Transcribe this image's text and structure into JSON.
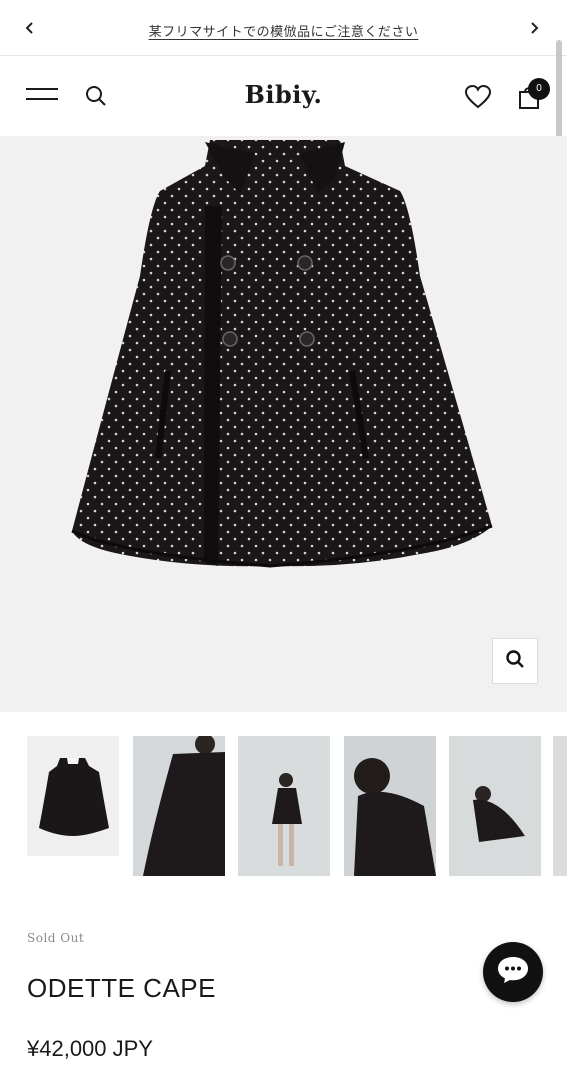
{
  "announcement": {
    "message": "某フリマサイトでの模倣品にご注意ください",
    "prev_icon": "chevron-left-icon",
    "next_icon": "chevron-right-icon"
  },
  "header": {
    "logo": "Bibiy.",
    "menu_icon": "hamburger-icon",
    "search_icon": "search-icon",
    "wishlist_icon": "heart-icon",
    "cart_icon": "shopping-bag-icon",
    "cart_count": "0"
  },
  "gallery": {
    "zoom_icon": "search-icon",
    "thumbnail_count": 6,
    "background": "#f1f1f1"
  },
  "product": {
    "status": "Sold Out",
    "title": "ODETTE CAPE",
    "price": "¥42,000 JPY"
  },
  "chat": {
    "icon": "chat-bubble-icon"
  },
  "colors": {
    "text": "#1a1a1a",
    "muted": "#8a8a8a",
    "accent": "#111111"
  }
}
